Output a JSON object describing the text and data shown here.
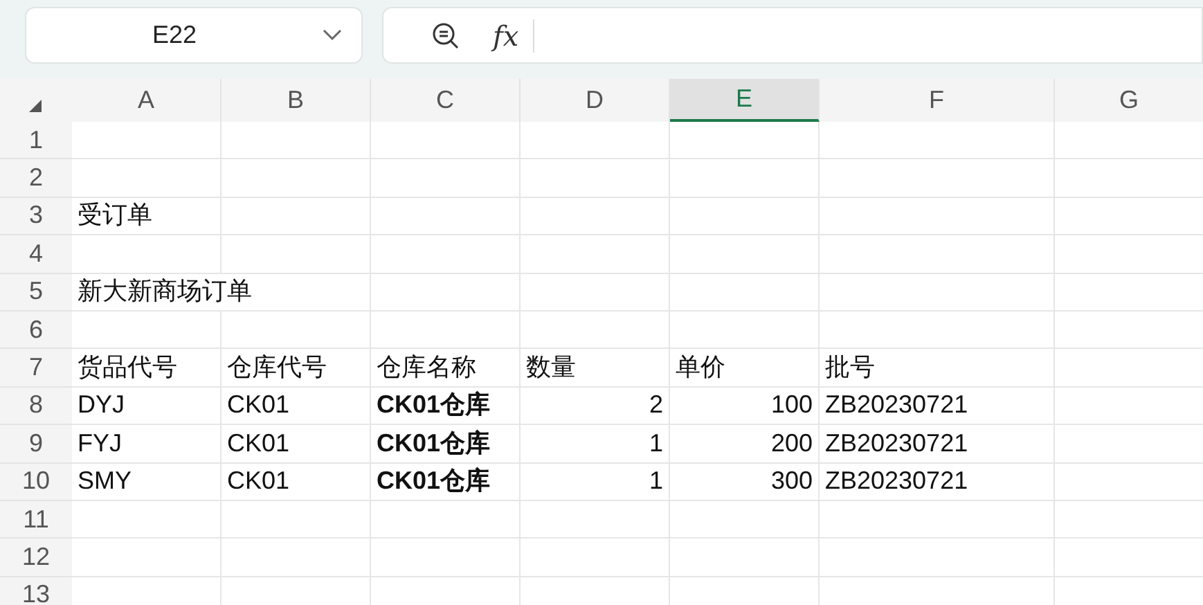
{
  "name_box": {
    "value": "E22"
  },
  "formula_bar": {
    "fx_label": "fx"
  },
  "columns": [
    {
      "label": "A",
      "selected": false
    },
    {
      "label": "B",
      "selected": false
    },
    {
      "label": "C",
      "selected": false
    },
    {
      "label": "D",
      "selected": false
    },
    {
      "label": "E",
      "selected": true
    },
    {
      "label": "F",
      "selected": false
    },
    {
      "label": "G",
      "selected": false
    }
  ],
  "rows": [
    {
      "label": "1",
      "cells": [
        null,
        null,
        null,
        null,
        null,
        null,
        null
      ]
    },
    {
      "label": "2",
      "cells": [
        null,
        null,
        null,
        null,
        null,
        null,
        null
      ]
    },
    {
      "label": "3",
      "cells": [
        {
          "text": "受订单",
          "kind": "text",
          "bold": false
        },
        null,
        null,
        null,
        null,
        null,
        null
      ]
    },
    {
      "label": "4",
      "cells": [
        null,
        null,
        null,
        null,
        null,
        null,
        null
      ]
    },
    {
      "label": "5",
      "cells": [
        {
          "text": "新大新商场订单",
          "kind": "text",
          "bold": false
        },
        null,
        null,
        null,
        null,
        null,
        null
      ]
    },
    {
      "label": "6",
      "cells": [
        null,
        null,
        null,
        null,
        null,
        null,
        null
      ]
    },
    {
      "label": "7",
      "cells": [
        {
          "text": "货品代号",
          "kind": "text",
          "bold": false
        },
        {
          "text": "仓库代号",
          "kind": "text",
          "bold": false
        },
        {
          "text": "仓库名称",
          "kind": "text",
          "bold": false
        },
        {
          "text": "数量",
          "kind": "text",
          "bold": false
        },
        {
          "text": "单价",
          "kind": "text",
          "bold": false
        },
        {
          "text": "批号",
          "kind": "text",
          "bold": false
        },
        null
      ]
    },
    {
      "label": "8",
      "cells": [
        {
          "text": "DYJ",
          "kind": "text",
          "bold": false
        },
        {
          "text": "CK01",
          "kind": "text",
          "bold": false
        },
        {
          "text": "CK01仓库",
          "kind": "text",
          "bold": true
        },
        {
          "text": "2",
          "kind": "number",
          "bold": false
        },
        {
          "text": "100",
          "kind": "number",
          "bold": false
        },
        {
          "text": "ZB20230721",
          "kind": "text",
          "bold": false
        },
        null
      ]
    },
    {
      "label": "9",
      "cells": [
        {
          "text": "FYJ",
          "kind": "text",
          "bold": false
        },
        {
          "text": "CK01",
          "kind": "text",
          "bold": false
        },
        {
          "text": "CK01仓库",
          "kind": "text",
          "bold": true
        },
        {
          "text": "1",
          "kind": "number",
          "bold": false
        },
        {
          "text": "200",
          "kind": "number",
          "bold": false
        },
        {
          "text": "ZB20230721",
          "kind": "text",
          "bold": false
        },
        null
      ]
    },
    {
      "label": "10",
      "cells": [
        {
          "text": "SMY",
          "kind": "text",
          "bold": false
        },
        {
          "text": "CK01",
          "kind": "text",
          "bold": false
        },
        {
          "text": "CK01仓库",
          "kind": "text",
          "bold": true
        },
        {
          "text": "1",
          "kind": "number",
          "bold": false
        },
        {
          "text": "300",
          "kind": "number",
          "bold": false
        },
        {
          "text": "ZB20230721",
          "kind": "text",
          "bold": false
        },
        null
      ]
    },
    {
      "label": "11",
      "cells": [
        null,
        null,
        null,
        null,
        null,
        null,
        null
      ]
    },
    {
      "label": "12",
      "cells": [
        null,
        null,
        null,
        null,
        null,
        null,
        null
      ]
    },
    {
      "label": "13",
      "cells": [
        null,
        null,
        null,
        null,
        null,
        null,
        null
      ]
    }
  ]
}
